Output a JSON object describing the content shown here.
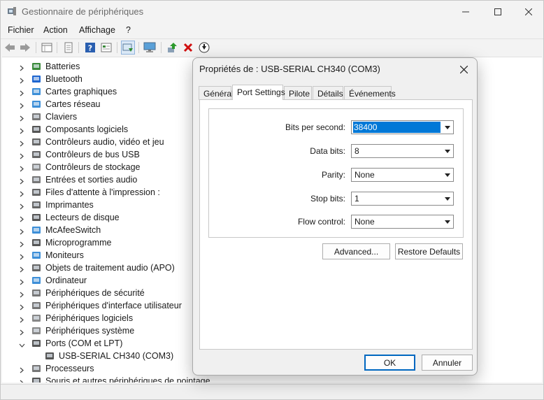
{
  "window": {
    "title": "Gestionnaire de périphériques"
  },
  "menu": [
    "Fichier",
    "Action",
    "Affichage",
    "?"
  ],
  "tree": {
    "items": [
      "Batteries",
      "Bluetooth",
      "Cartes graphiques",
      "Cartes réseau",
      "Claviers",
      "Composants logiciels",
      "Contrôleurs audio, vidéo et jeu",
      "Contrôleurs de bus USB",
      "Contrôleurs de stockage",
      "Entrées et sorties audio",
      "Files d'attente à l'impression :",
      "Imprimantes",
      "Lecteurs de disque",
      "McAfeeSwitch",
      "Microprogramme",
      "Moniteurs",
      "Objets de traitement audio (APO)",
      "Ordinateur",
      "Périphériques de sécurité",
      "Périphériques d'interface utilisateur",
      "Périphériques logiciels",
      "Périphériques système",
      "Ports (COM et LPT)"
    ],
    "expanded_child": "USB-SERIAL CH340 (COM3)",
    "after_items": [
      "Processeurs",
      "Souris et autres périphériques de pointage"
    ]
  },
  "dialog": {
    "title": "Propriétés de : USB-SERIAL CH340 (COM3)",
    "tabs": [
      "Général",
      "Port Settings",
      "Pilote",
      "Détails",
      "Événements"
    ],
    "active_tab": "Port Settings",
    "fields": {
      "bits_per_second": {
        "label": "Bits per second:",
        "value": "38400"
      },
      "data_bits": {
        "label": "Data bits:",
        "value": "8"
      },
      "parity": {
        "label": "Parity:",
        "value": "None"
      },
      "stop_bits": {
        "label": "Stop bits:",
        "value": "1"
      },
      "flow_control": {
        "label": "Flow control:",
        "value": "None"
      }
    },
    "advanced_button": "Advanced...",
    "restore_button": "Restore Defaults",
    "ok_button": "OK",
    "cancel_button": "Annuler"
  },
  "colors": {
    "selection": "#0078d7",
    "accent_border": "#0067c0"
  }
}
